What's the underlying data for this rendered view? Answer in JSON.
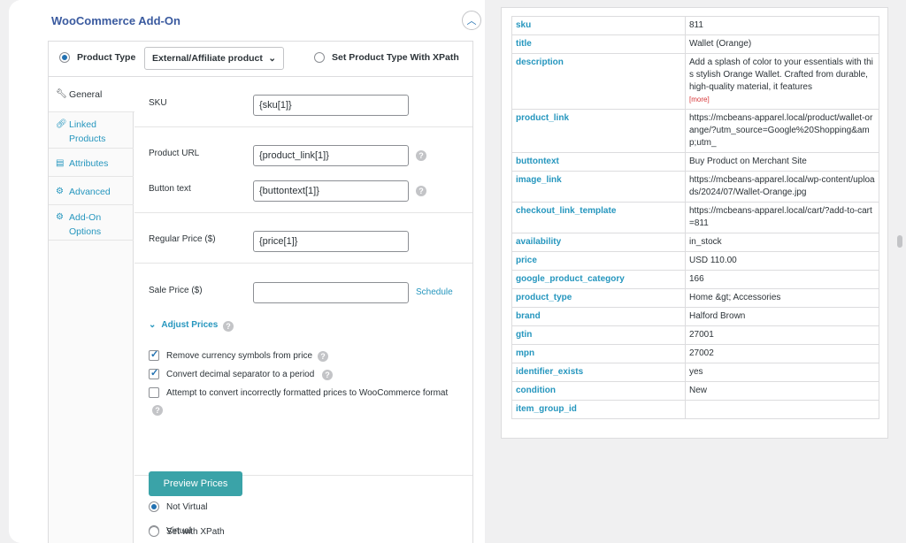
{
  "addon": {
    "title": "WooCommerce Add-On"
  },
  "product_type": {
    "label": "Product Type",
    "selected": "External/Affiliate product",
    "xpath_label": "Set Product Type With XPath"
  },
  "tabs": [
    {
      "label": "General",
      "icon": "wrench-icon"
    },
    {
      "label": "Linked Products",
      "icon": "link-icon"
    },
    {
      "label": "Attributes",
      "icon": "list-icon"
    },
    {
      "label": "Advanced",
      "icon": "gear-icon"
    },
    {
      "label": "Add-On Options",
      "icon": "gear-icon"
    }
  ],
  "general": {
    "sku_label": "SKU",
    "sku_value": "{sku[1]}",
    "product_url_label": "Product URL",
    "product_url_value": "{product_link[1]}",
    "button_text_label": "Button text",
    "button_text_value": "{buttontext[1]}",
    "regular_price_label": "Regular Price ($)",
    "regular_price_value": "{price[1]}",
    "sale_price_label": "Sale Price ($)",
    "sale_price_value": "",
    "schedule_link": "Schedule",
    "adjust_prices_label": "Adjust Prices",
    "options": [
      {
        "label": "Remove currency symbols from price",
        "checked": true
      },
      {
        "label": "Convert decimal separator to a period",
        "checked": true
      },
      {
        "label": "Attempt to convert incorrectly formatted prices to WooCommerce format",
        "checked": false
      }
    ],
    "preview_button": "Preview Prices",
    "virtual_options": [
      {
        "label": "Virtual",
        "selected": false
      },
      {
        "label": "Not Virtual",
        "selected": true
      },
      {
        "label": "Set with XPath",
        "selected": false
      }
    ]
  },
  "record": {
    "sku": "811",
    "title": "Wallet (Orange)",
    "description": "Add a splash of color to your essentials with this stylish Orange Wallet. Crafted from durable, high-quality material, it features",
    "more": "[more]",
    "product_link": "https://mcbeans-apparel.local/product/wallet-orange/?utm_source=Google%20Shopping&amp;utm_",
    "buttontext": "Buy Product on Merchant Site",
    "image_link": "https://mcbeans-apparel.local/wp-content/uploads/2024/07/Wallet-Orange.jpg",
    "checkout_link_template": "https://mcbeans-apparel.local/cart/?add-to-cart=811",
    "availability": "in_stock",
    "price": "USD 110.00",
    "google_product_category": "166",
    "product_type": "Home &gt; Accessories",
    "brand": "Halford Brown",
    "gtin": "27001",
    "mpn": "27002",
    "identifier_exists": "yes",
    "condition": "New",
    "item_group_id": ""
  },
  "record_keys": {
    "sku": "sku",
    "title": "title",
    "description": "description",
    "product_link": "product_link",
    "buttontext": "buttontext",
    "image_link": "image_link",
    "checkout_link_template": "checkout_link_template",
    "availability": "availability",
    "price": "price",
    "google_product_category": "google_product_category",
    "product_type": "product_type",
    "brand": "brand",
    "gtin": "gtin",
    "mpn": "mpn",
    "identifier_exists": "identifier_exists",
    "condition": "condition",
    "item_group_id": "item_group_id"
  },
  "colors": {
    "accent": "#2596be",
    "button": "#3aa3a8",
    "title": "#3a5a9f"
  }
}
